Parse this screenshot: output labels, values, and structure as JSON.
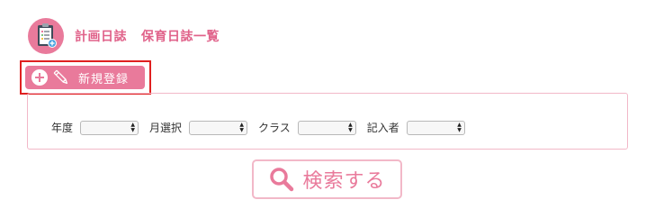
{
  "header": {
    "icon": "clipboard-icon",
    "title_part1": "計画日誌",
    "title_part2": "保育日誌一覧"
  },
  "new_button": {
    "label": "新規登録",
    "icons": [
      "plus-circle-icon",
      "pencil-icon"
    ]
  },
  "filters": {
    "year_label": "年度",
    "month_label": "月選択",
    "class_label": "クラス",
    "author_label": "記入者"
  },
  "search_button": {
    "label": "検索する",
    "icon": "magnifier-icon"
  },
  "colors": {
    "brand_pink": "#e97a9b",
    "title_pink": "#e0628a",
    "panel_border": "#f2b8c8",
    "highlight_red": "#e02020"
  }
}
